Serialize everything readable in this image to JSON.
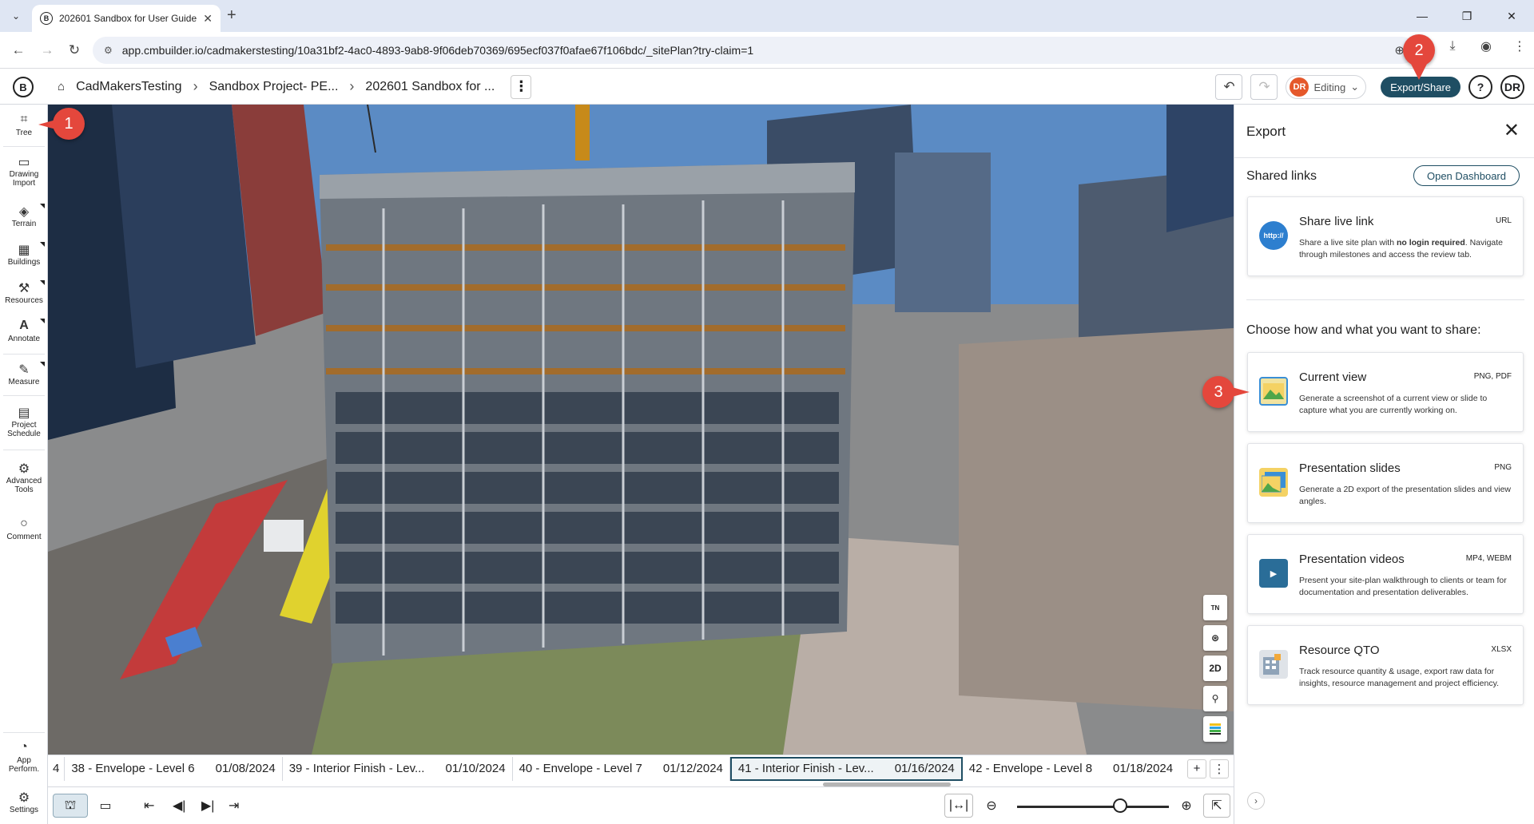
{
  "browser": {
    "tab_title": "202601 Sandbox for User Guide",
    "url": "app.cmbuilder.io/cadmakerstesting/10a31bf2-4ac0-4893-9ab8-9f06deb70369/695ecf037f0afae67f106bdc/_sitePlan?try-claim=1"
  },
  "header": {
    "breadcrumbs": [
      "CadMakersTesting",
      "Sandbox Project- PE...",
      "202601 Sandbox for ..."
    ],
    "user_initials": "DR",
    "editing_label": "Editing",
    "export_label": "Export/Share",
    "help_label": "?",
    "avatar_label": "DR"
  },
  "left_tools": [
    {
      "label": "Tree",
      "icon": "tree-icon"
    },
    {
      "label": "Drawing Import",
      "icon": "drawing-import-icon"
    },
    {
      "label": "Terrain",
      "icon": "terrain-icon"
    },
    {
      "label": "Buildings",
      "icon": "buildings-icon"
    },
    {
      "label": "Resources",
      "icon": "resources-icon"
    },
    {
      "label": "Annotate",
      "icon": "annotate-icon"
    },
    {
      "label": "Measure",
      "icon": "measure-icon"
    },
    {
      "label": "Project Schedule",
      "icon": "project-schedule-icon"
    },
    {
      "label": "Advanced Tools",
      "icon": "advanced-tools-icon"
    },
    {
      "label": "Comment",
      "icon": "comment-icon"
    },
    {
      "label": "App Perform.",
      "icon": "app-performance-icon"
    },
    {
      "label": "Settings",
      "icon": "settings-icon"
    }
  ],
  "viewport_tools": [
    "TN",
    "",
    "2D",
    "",
    ""
  ],
  "timeline": {
    "milestones": [
      {
        "name": "4",
        "date": ""
      },
      {
        "name": "38 - Envelope - Level 6",
        "date": "01/08/2024"
      },
      {
        "name": "39 - Interior Finish - Lev...",
        "date": "01/10/2024"
      },
      {
        "name": "40 - Envelope - Level 7",
        "date": "01/12/2024"
      },
      {
        "name": "41 - Interior Finish - Lev...",
        "date": "01/16/2024"
      },
      {
        "name": "42 - Envelope - Level 8",
        "date": "01/18/2024"
      }
    ],
    "active_index": 4,
    "add_label": "+",
    "more_label": "⋮"
  },
  "zoom_level": 0.55,
  "export_panel": {
    "title": "Export",
    "shared_links_label": "Shared links",
    "open_dashboard_label": "Open Dashboard",
    "choose_label": "Choose how and what you want to share:",
    "share_link": {
      "title": "Share live link",
      "ext": "URL",
      "desc_pre": "Share a live site plan with ",
      "desc_bold": "no login required",
      "desc_post": ". Navigate through milestones and access the review tab.",
      "icon_text": "http://"
    },
    "options": [
      {
        "title": "Current view",
        "ext": "PNG, PDF",
        "desc": "Generate a screenshot of a current view or slide to capture what you are currently working on.",
        "icon": "current-view-icon"
      },
      {
        "title": "Presentation slides",
        "ext": "PNG",
        "desc": "Generate a 2D export of the presentation slides and view angles.",
        "icon": "presentation-slides-icon"
      },
      {
        "title": "Presentation videos",
        "ext": "MP4, WEBM",
        "desc": "Present your site-plan walkthrough to clients or team for documentation and presentation deliverables.",
        "icon": "presentation-videos-icon"
      },
      {
        "title": "Resource QTO",
        "ext": "XLSX",
        "desc": "Track resource quantity & usage, export raw data for insights, resource management and project efficiency.",
        "icon": "resource-qto-icon"
      }
    ]
  },
  "callouts": [
    "1",
    "2",
    "3"
  ],
  "colors": {
    "accent": "#1f4e63",
    "callout": "#e4473c",
    "user_badge": "#e5582b"
  }
}
